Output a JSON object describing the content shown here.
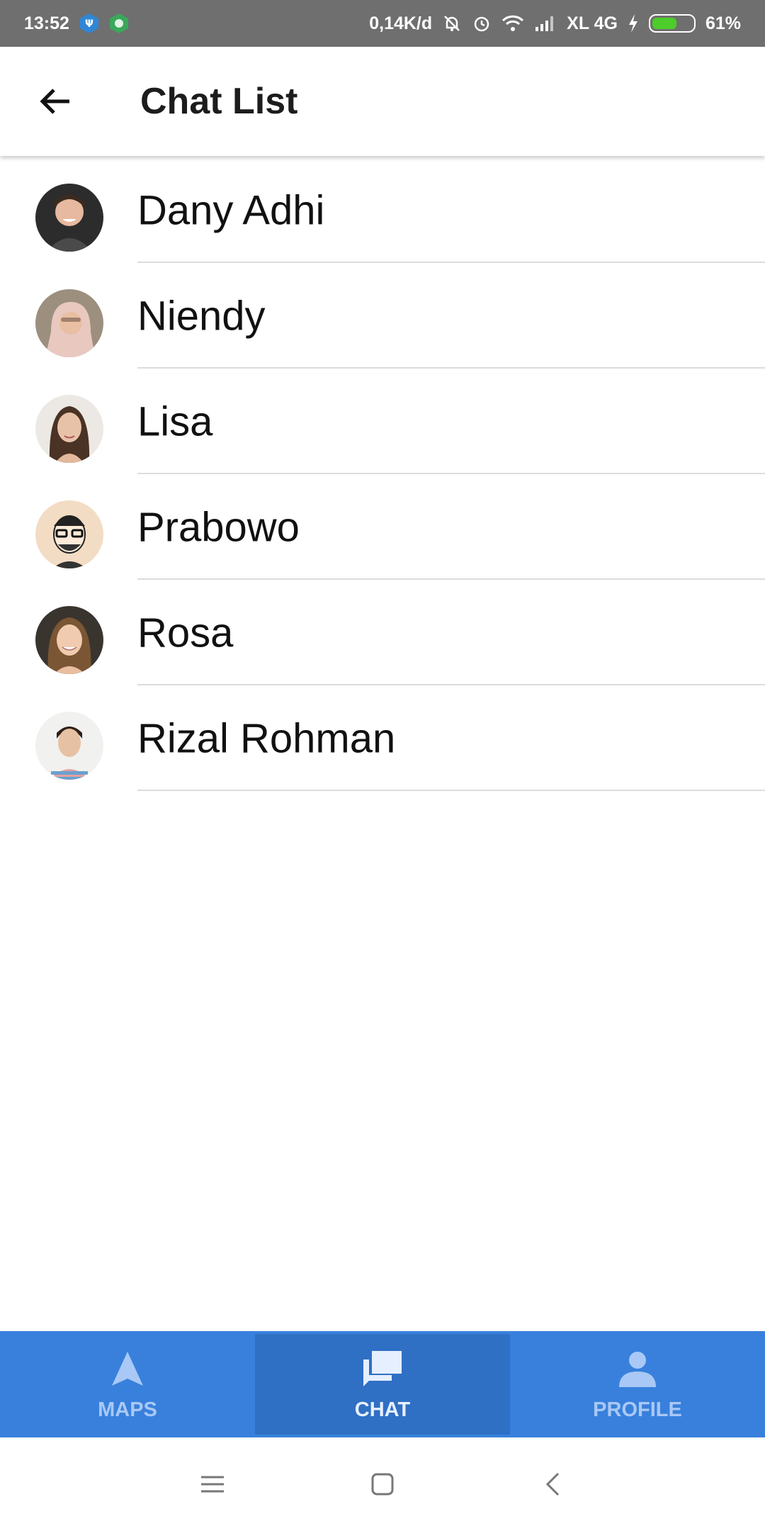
{
  "status_bar": {
    "time": "13:52",
    "network_speed": "0,14K/d",
    "carrier": "XL 4G",
    "battery_percent": "61%",
    "battery_level": 0.61,
    "icons": [
      "app-notification-icon-1",
      "app-notification-icon-2",
      "mute-bell-icon",
      "alarm-icon",
      "wifi-icon",
      "signal-icon",
      "charging-icon",
      "battery-icon"
    ]
  },
  "appbar": {
    "title": "Chat List",
    "back_icon": "arrow-left-icon"
  },
  "chats": [
    {
      "name": "Dany Adhi"
    },
    {
      "name": "Niendy"
    },
    {
      "name": "Lisa"
    },
    {
      "name": "Prabowo"
    },
    {
      "name": "Rosa"
    },
    {
      "name": "Rizal Rohman"
    }
  ],
  "bottom_nav": {
    "items": [
      {
        "label": "MAPS",
        "icon": "navigation-arrow-icon",
        "active": false
      },
      {
        "label": "CHAT",
        "icon": "chat-bubbles-icon",
        "active": true
      },
      {
        "label": "PROFILE",
        "icon": "person-icon",
        "active": false
      }
    ]
  },
  "colors": {
    "nav_background": "#3880dc",
    "nav_active": "#2f6fc4",
    "status_bar": "#6f6f6f",
    "battery_fill": "#4ccd2a"
  },
  "system_nav": {
    "icons": [
      "menu-icon",
      "home-square-icon",
      "back-chevron-icon"
    ]
  }
}
